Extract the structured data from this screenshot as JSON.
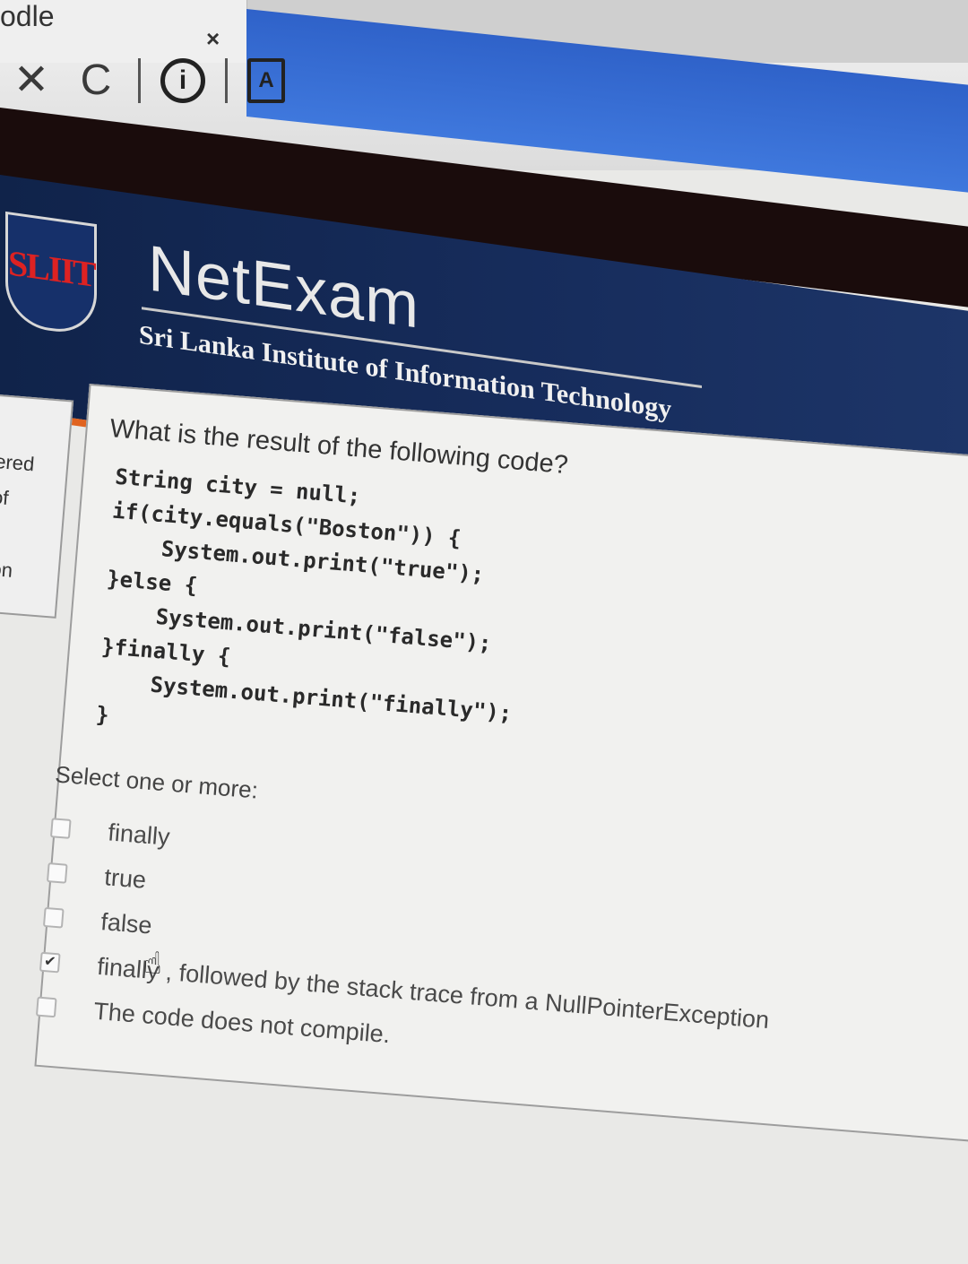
{
  "browser": {
    "tab_title": "odle",
    "tab_close": "×",
    "nav_close": "✕",
    "nav_reload": "C",
    "info": "i",
    "pdf": "A"
  },
  "header": {
    "logo_text": "SLIIT",
    "title": "NetExam",
    "subtitle": "Sri Lanka Institute of Information Technology",
    "accent_color": "#e0631f",
    "banner_color": "#172d5d"
  },
  "sidebar": {
    "lines": [
      "ered",
      "of",
      "ion"
    ]
  },
  "question": {
    "text": "What is the result of the following code?",
    "code": "String city = null;\nif(city.equals(\"Boston\")) {\n    System.out.print(\"true\");\n}else {\n    System.out.print(\"false\");\n}finally {\n    System.out.print(\"finally\");\n}",
    "select_label": "Select one or more:",
    "options": [
      {
        "label": "finally",
        "checked": false
      },
      {
        "label": "true",
        "checked": false
      },
      {
        "label": "false",
        "checked": false
      },
      {
        "label": "finally , followed by the stack trace from a NullPointerException",
        "checked": true
      },
      {
        "label": "The code does not compile.",
        "checked": false
      }
    ]
  }
}
